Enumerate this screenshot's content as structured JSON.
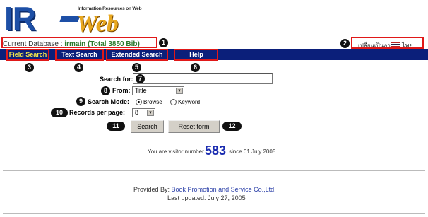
{
  "logo": {
    "brand_primary": "IR",
    "brand_dash": "-",
    "brand_secondary": "Web",
    "tagline": "Information Resources on Web"
  },
  "database": {
    "label": "Current Database :",
    "name": "irmain (Total 3850 Bib)"
  },
  "language": {
    "switch_text": "เปลี่ยนเป็นภาษา",
    "thai_label": "ไทย",
    "flag_icon": "uk-flag-icon"
  },
  "tabs": [
    {
      "label": "Field Search"
    },
    {
      "label": "Text Search"
    },
    {
      "label": "Extended Search"
    },
    {
      "label": "Help"
    }
  ],
  "form": {
    "search_for_label": "Search for:",
    "search_value": "",
    "from_label": "From:",
    "from_value": "Title",
    "mode_label": "Search Mode:",
    "mode_browse": "Browse",
    "mode_keyword": "Keyword",
    "mode_selected": "Browse",
    "records_label": "Records per page:",
    "records_value": "8",
    "search_button": "Search",
    "reset_button": "Reset form"
  },
  "visitor": {
    "prefix": "You are visitor number",
    "count": "583",
    "suffix": "since 01 July 2005"
  },
  "footer": {
    "provided_label": "Provided By:",
    "provider": "Book Promotion and Service Co.,Ltd.",
    "updated": "Last updated: July 27, 2005"
  },
  "annotations": [
    "1",
    "2",
    "3",
    "4",
    "5",
    "6",
    "7",
    "8",
    "9",
    "10",
    "11",
    "12"
  ],
  "colors": {
    "nav_background": "#0b1f7a",
    "active_tab_text": "#f2e64a",
    "highlight_box": "#e01818",
    "visitor_count": "#1a2bb0",
    "database_name": "#2c7a2c",
    "logo_blue": "#1d4fa6",
    "logo_orange": "#e8a81f"
  }
}
